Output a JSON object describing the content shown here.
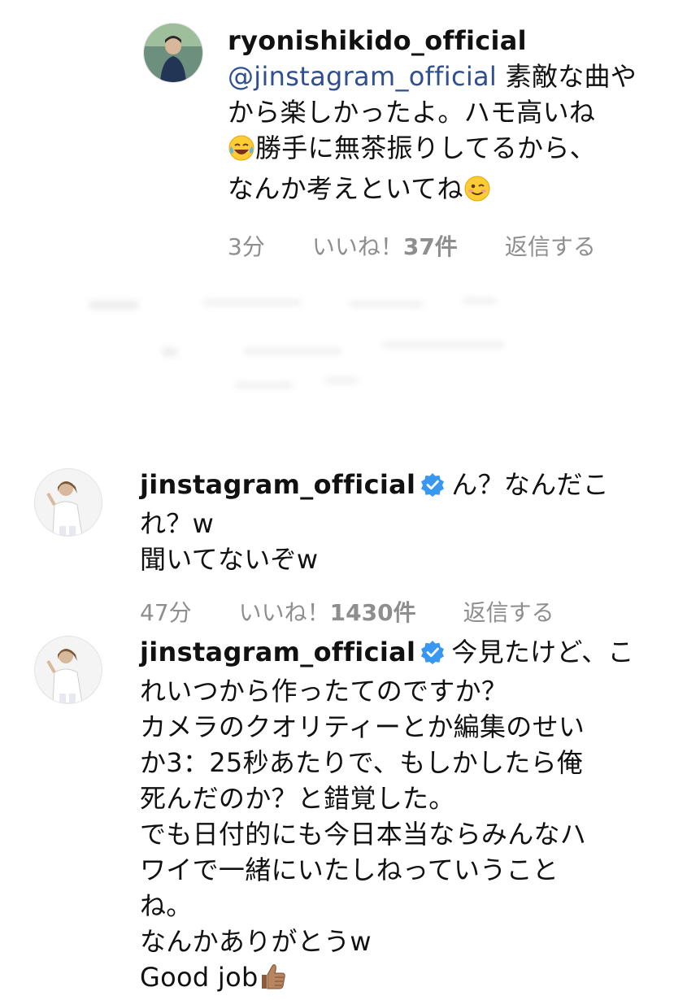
{
  "comments": [
    {
      "username": "ryonishikido_official",
      "verified": false,
      "mention": "@jinstagram_official",
      "lines": [
        " 素敵な曲や",
        "から楽しかったよ。ハモ高いね",
        "勝手に無茶振りしてるから、",
        "なんか考えといてね"
      ],
      "time": "3分",
      "likes_prefix": "いいね！",
      "likes_count": "37件",
      "reply": "返信する"
    },
    {
      "username": "jinstagram_official",
      "verified": true,
      "lines": [
        "ん？なんだこ",
        "れ？w",
        "聞いてないぞw"
      ],
      "time": "47分",
      "likes_prefix": "いいね！",
      "likes_count": "1430件",
      "reply": "返信する"
    },
    {
      "username": "jinstagram_official",
      "verified": true,
      "lines": [
        "今見たけど、こ",
        "れいつから作ったてのですか？",
        "カメラのクオリティーとか編集のせい",
        "か3：25秒あたりで、もしかしたら俺",
        "死んだのか？と錯覚した。",
        "でも日付的にも今日本当ならみんなハ",
        "ワイで一緒にいたしねっていうこと",
        "ね。",
        "なんかありがとうw",
        "Good job"
      ]
    }
  ],
  "icons": {
    "laugh": "face-with-tears-of-joy-icon",
    "wink": "winking-face-icon",
    "thumbs": "thumbs-up-icon",
    "verified": "verified-badge-icon"
  },
  "colors": {
    "mention": "#2f4f8f",
    "meta": "#8e8e8e",
    "verified": "#3897f0"
  }
}
